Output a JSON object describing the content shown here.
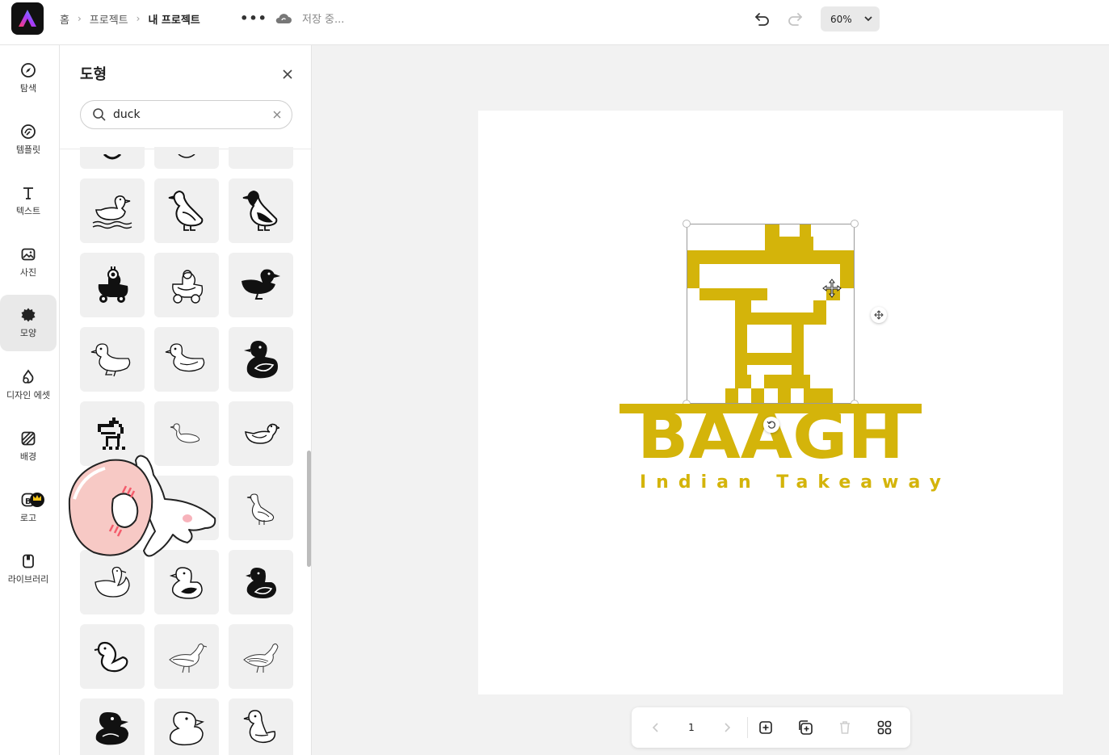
{
  "topbar": {
    "breadcrumbs": [
      "홈",
      "프로젝트",
      "내 프로젝트"
    ],
    "more_label": "•••",
    "save_status": "저장 중...",
    "zoom": "60%"
  },
  "rail": {
    "items": [
      {
        "label": "탐색",
        "icon": "compass-icon"
      },
      {
        "label": "템플릿",
        "icon": "template-icon"
      },
      {
        "label": "텍스트",
        "icon": "text-icon"
      },
      {
        "label": "사진",
        "icon": "photo-icon"
      },
      {
        "label": "모양",
        "icon": "shape-icon"
      },
      {
        "label": "디자인 에셋",
        "icon": "design-assets-icon"
      },
      {
        "label": "배경",
        "icon": "background-icon"
      },
      {
        "label": "로고",
        "icon": "logo-icon"
      },
      {
        "label": "라이브러리",
        "icon": "library-icon"
      }
    ],
    "active": "모양"
  },
  "panel": {
    "title": "도형",
    "search_value": "duck"
  },
  "canvas": {
    "brand_name": "BAAGH",
    "brand_tagline": "Indian Takeaway",
    "brand_color": "#d4b40a"
  },
  "page_nav": {
    "page_number": "1"
  }
}
